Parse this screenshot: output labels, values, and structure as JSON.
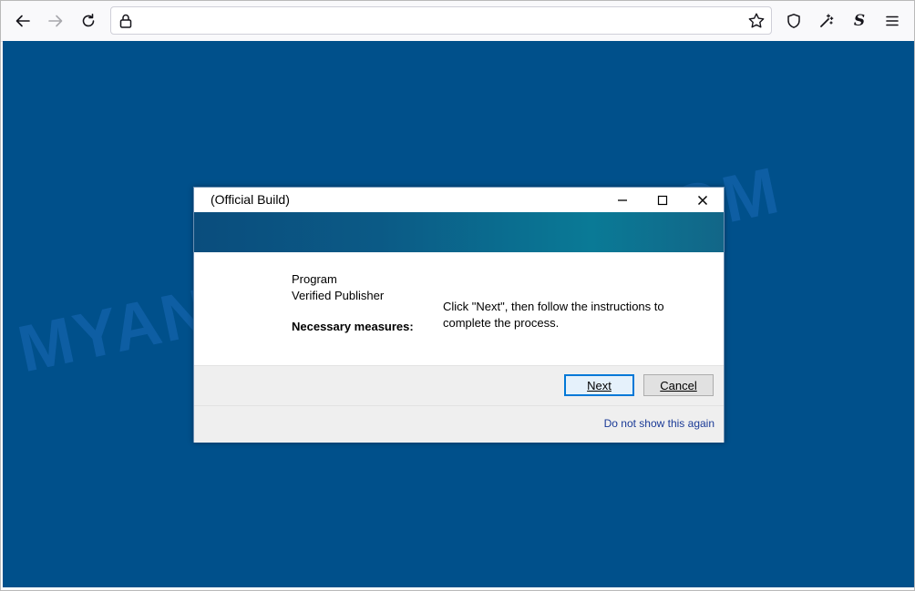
{
  "browser": {
    "url": "",
    "icons": {
      "back": "arrow-left-icon",
      "forward": "arrow-right-icon",
      "reload": "reload-icon",
      "lock": "lock-icon",
      "bookmark": "star-icon",
      "tracking_protection": "shield-icon",
      "extension_wand": "magic-wand-icon",
      "extension_s": "S",
      "menu": "hamburger-menu-icon"
    }
  },
  "page": {
    "background_color": "#00508b",
    "watermark": "MYANTISPYWARE.COM"
  },
  "dialog": {
    "title": "(Official Build)",
    "controls": {
      "minimize": "–",
      "maximize": "☐",
      "close": "✕"
    },
    "labels": {
      "program": "Program",
      "publisher": "Verified Publisher",
      "measures": "Necessary measures:"
    },
    "message": "Click \"Next\", then follow the instructions to complete the process.",
    "buttons": {
      "next": "Next",
      "cancel": "Cancel"
    },
    "dont_show_link": "Do not show this again"
  }
}
